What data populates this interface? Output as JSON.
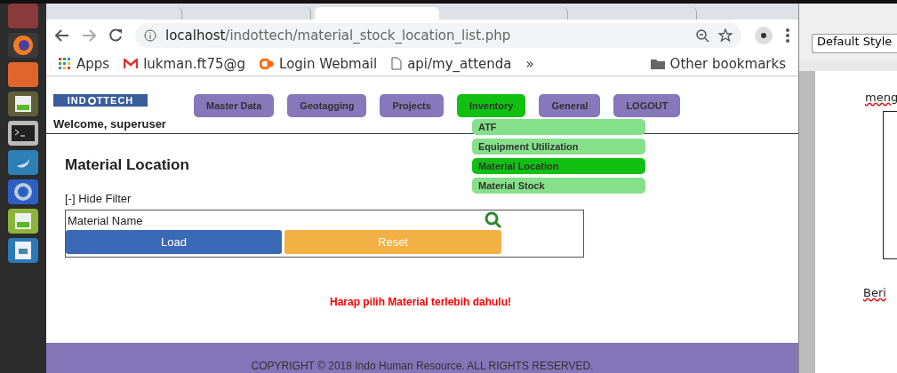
{
  "browser": {
    "tabs": [
      {
        "selected": false
      },
      {
        "selected": false
      },
      {
        "selected": true
      },
      {
        "selected": false
      },
      {
        "selected": false
      }
    ],
    "address": {
      "host": "localhost",
      "path": "/indottech/material_stock_location_list.php"
    },
    "bookmarks": [
      {
        "kind": "apps",
        "label": "Apps"
      },
      {
        "kind": "mail",
        "label": "lukman.ft75@g"
      },
      {
        "kind": "cpanel",
        "label": "Login Webmail"
      },
      {
        "kind": "page",
        "label": "api/my_attenda"
      },
      {
        "kind": "overflow",
        "label": "»"
      },
      {
        "kind": "folder",
        "label": "Other bookmarks"
      }
    ]
  },
  "page": {
    "logo": {
      "left": "IND",
      "right": "TTECH"
    },
    "nav": [
      {
        "label": "Master Data",
        "selected": false
      },
      {
        "label": "Geotagging",
        "selected": false
      },
      {
        "label": "Projects",
        "selected": false
      },
      {
        "label": "Inventory",
        "selected": true
      },
      {
        "label": "General",
        "selected": false
      },
      {
        "label": "LOGOUT",
        "selected": false
      }
    ],
    "welcome": "Welcome, superuser",
    "dropdown": [
      {
        "label": "ATF",
        "selected": false
      },
      {
        "label": "Equipment Utilization",
        "selected": false
      },
      {
        "label": "Material Location",
        "selected": true
      },
      {
        "label": "Material Stock",
        "selected": false
      }
    ],
    "title": "Material Location",
    "filter_toggle": "[-] Hide Filter",
    "field_label": "Material Name",
    "buttons": [
      {
        "kind": "primary",
        "label": "Load"
      },
      {
        "kind": "warning",
        "label": "Reset"
      }
    ],
    "error": "Harap pilih Material terlebih dahulu!",
    "footer": "COPYRIGHT © 2018 Indo Human Resource. ALL RIGHTS RESERVED."
  },
  "document": {
    "style_select": "Default Style",
    "text_1": "meng",
    "text_2": "Beri"
  }
}
